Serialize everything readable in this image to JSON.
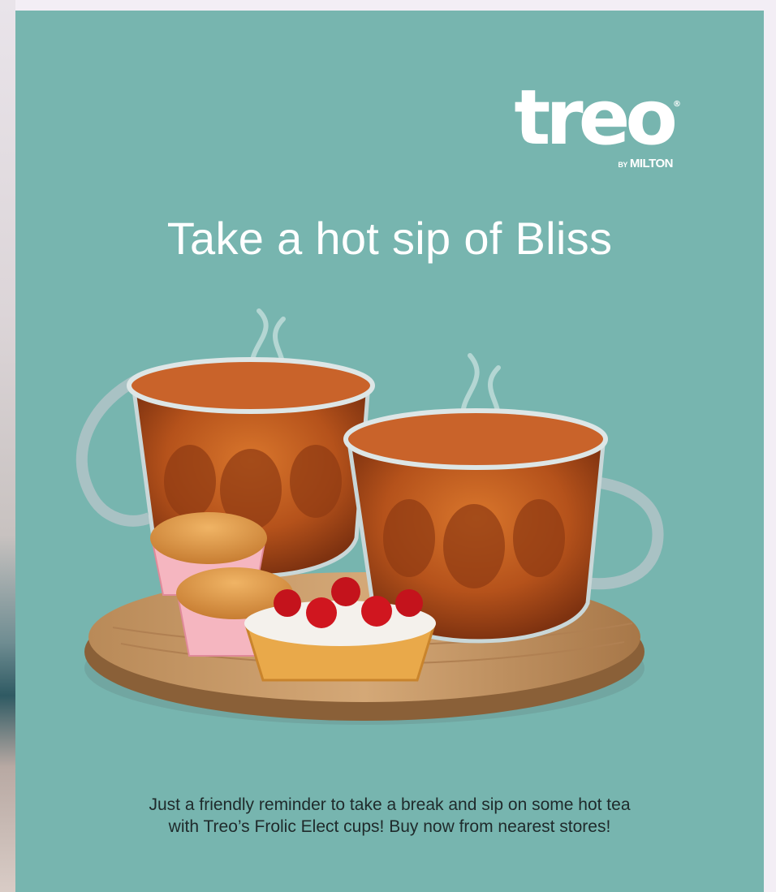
{
  "brand": {
    "name": "treo",
    "by": "BY",
    "maker": "MILTON",
    "reg": "®"
  },
  "headline": "Take a hot sip of Bliss",
  "caption": {
    "line1": "Just a friendly reminder to take a break and sip on some hot tea",
    "line2": "with Treo’s Frolic Elect cups! Buy now from nearest stores!"
  },
  "colors": {
    "background": "#77b5af",
    "text_light": "#ffffff",
    "text_dark": "#1f2a2b",
    "tea": "#b8521a",
    "wood": "#c99a66"
  }
}
